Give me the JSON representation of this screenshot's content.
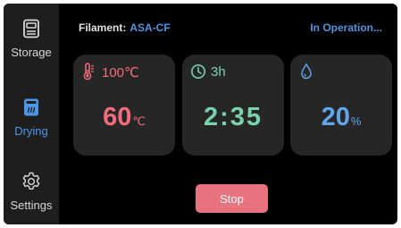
{
  "sidebar": {
    "items": [
      {
        "label": "Storage",
        "icon": "storage-icon",
        "active": false
      },
      {
        "label": "Drying",
        "icon": "drying-icon",
        "active": true
      },
      {
        "label": "Settings",
        "icon": "gear-icon",
        "active": false
      }
    ]
  },
  "header": {
    "filament_label": "Filament:",
    "filament_value": "ASA-CF",
    "status": "In Operation..."
  },
  "cards": {
    "temperature": {
      "icon": "thermometer-icon",
      "setpoint": "100℃",
      "value": "60",
      "unit": "℃"
    },
    "time": {
      "icon": "clock-icon",
      "setpoint": "3h",
      "value": "2:35"
    },
    "humidity": {
      "icon": "droplet-icon",
      "value": "20",
      "unit": "%"
    }
  },
  "actions": {
    "stop_label": "Stop"
  },
  "colors": {
    "accent_blue": "#4d96e6",
    "temperature": "#f36c7d",
    "time": "#79d2af",
    "humidity": "#62a5ea",
    "stop_button": "#e8737f",
    "card_bg": "#262626",
    "sidebar_bg": "#1e1e1e"
  }
}
